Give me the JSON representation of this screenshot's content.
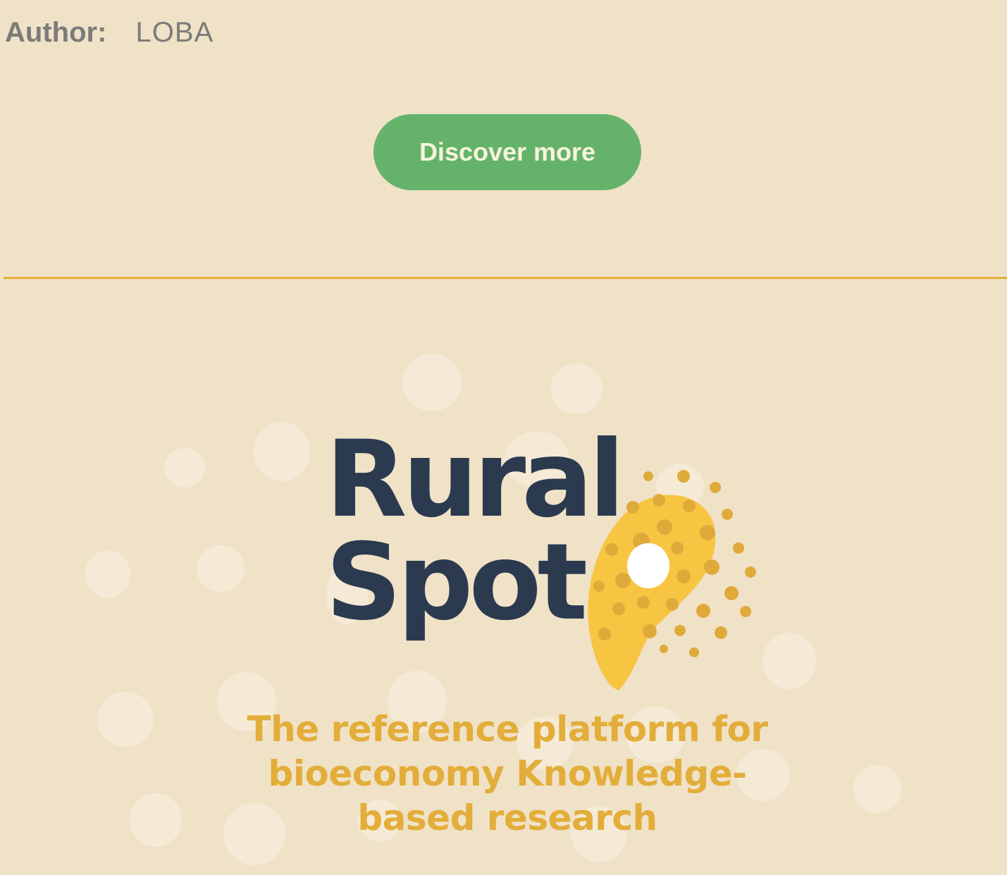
{
  "author": {
    "label": "Author:",
    "value": "LOBA"
  },
  "cta": {
    "label": "Discover more"
  },
  "colors": {
    "background": "#f0e2c7",
    "button": "#65b36b",
    "accent": "#e3ad3a",
    "logo_text": "#2b3a4f",
    "pin_fill": "#f8c543"
  },
  "brand": {
    "name_line1": "Rural",
    "name_line2": "Spot",
    "tagline": "The reference platform for bioeconomy Knowledge-based research"
  }
}
